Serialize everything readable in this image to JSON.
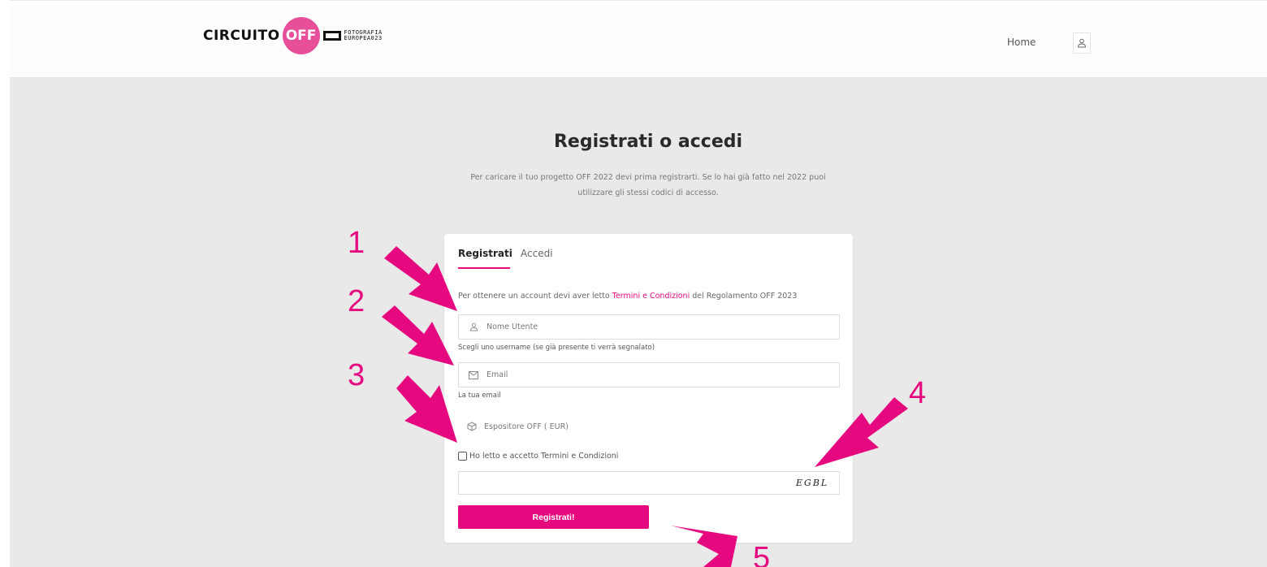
{
  "header": {
    "logo": {
      "circuito": "CIRCUITO",
      "off": "OFF",
      "line1": "FOTOGRAFIA",
      "line2": "EUROPEA023"
    },
    "nav": {
      "home": "Home"
    },
    "icons": {
      "user": "user-icon"
    }
  },
  "main": {
    "title": "Registrati o accedi",
    "subtitle_line1": "Per caricare il tuo progetto OFF 2022 devi prima registrarti. Se lo hai già fatto nel 2022 puoi",
    "subtitle_line2": "utilizzare gli stessi codici di accesso."
  },
  "form": {
    "tabs": {
      "register": "Registrati",
      "login": "Accedi"
    },
    "info": {
      "before": "Per ottenere un account devi aver letto ",
      "link": "Termini e Condizioni",
      "after": " del Regolamento OFF 2023"
    },
    "username": {
      "placeholder": "Nome Utente",
      "help": "Scegli uno username (se già presente ti verrà segnalato)"
    },
    "email": {
      "placeholder": "Email",
      "help": "La tua email"
    },
    "role": {
      "label": "Espositore OFF ( EUR)"
    },
    "terms": {
      "label": "Ho letto e accetto Termini e Condizioni"
    },
    "captcha": {
      "code": "EGBL"
    },
    "submit": "Registrati!"
  },
  "annotations": [
    "1",
    "2",
    "3",
    "4",
    "5"
  ],
  "colors": {
    "accent": "#e5087f",
    "logo_pink": "#e84f9a",
    "background": "#e9e9e9"
  }
}
